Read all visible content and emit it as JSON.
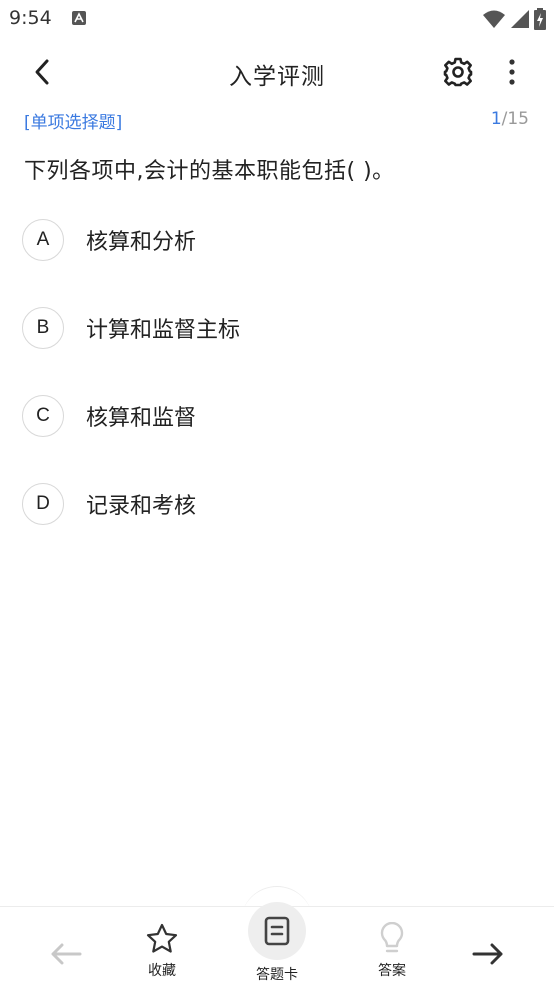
{
  "status_bar": {
    "time": "9:54",
    "icons": [
      "notification-a-icon",
      "wifi-icon",
      "signal-icon",
      "battery-charging-icon"
    ]
  },
  "app_bar": {
    "title": "入学评测",
    "icons": [
      "back-arrow-icon",
      "gear-icon",
      "more-vertical-icon"
    ]
  },
  "question": {
    "type_label": "[单项选择题]",
    "current": "1",
    "total": "/15",
    "text": "下列各项中,会计的基本职能包括(   )。",
    "options": [
      {
        "letter": "A",
        "text": "核算和分析"
      },
      {
        "letter": "B",
        "text": "计算和监督主标"
      },
      {
        "letter": "C",
        "text": "核算和监督"
      },
      {
        "letter": "D",
        "text": "记录和考核"
      }
    ]
  },
  "bottom_bar": {
    "prev_icon": "arrow-left-icon",
    "favorite_label": "收藏",
    "answer_card_label": "答题卡",
    "answer_label": "答案",
    "next_icon": "arrow-right-icon"
  },
  "colors": {
    "accent": "#3b7ae0",
    "text": "#222222",
    "muted": "#999999",
    "disabled": "#c8c8c8"
  }
}
